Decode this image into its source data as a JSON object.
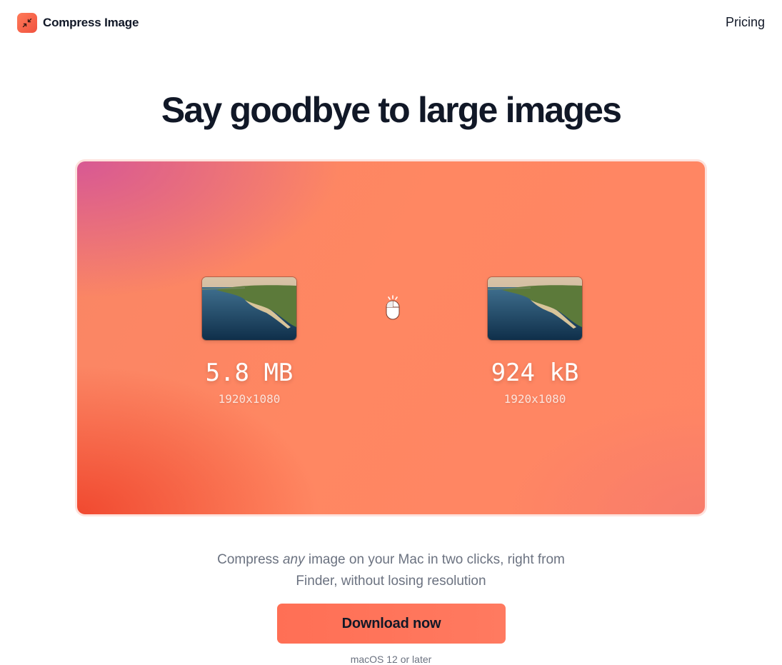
{
  "header": {
    "brand_name": "Compress Image",
    "brand_icon": "compress-arrows-icon",
    "nav_pricing": "Pricing"
  },
  "hero": {
    "title": "Say goodbye to large images"
  },
  "demo": {
    "before": {
      "size": "5.8 MB",
      "dimensions": "1920x1080",
      "thumbnail": "coastline-photo"
    },
    "after": {
      "size": "924 kB",
      "dimensions": "1920x1080",
      "thumbnail": "coastline-photo"
    },
    "action_icon": "mouse-click-icon"
  },
  "tagline": {
    "prefix": "Compress ",
    "emphasis": "any",
    "rest_line1": " image on your Mac in two clicks, right from",
    "line2": "Finder, without losing resolution"
  },
  "cta": {
    "download_label": "Download now",
    "requirement": "macOS 12 or later"
  },
  "colors": {
    "accent": "#ff7a60",
    "title": "#111827",
    "muted": "#6b7280"
  }
}
